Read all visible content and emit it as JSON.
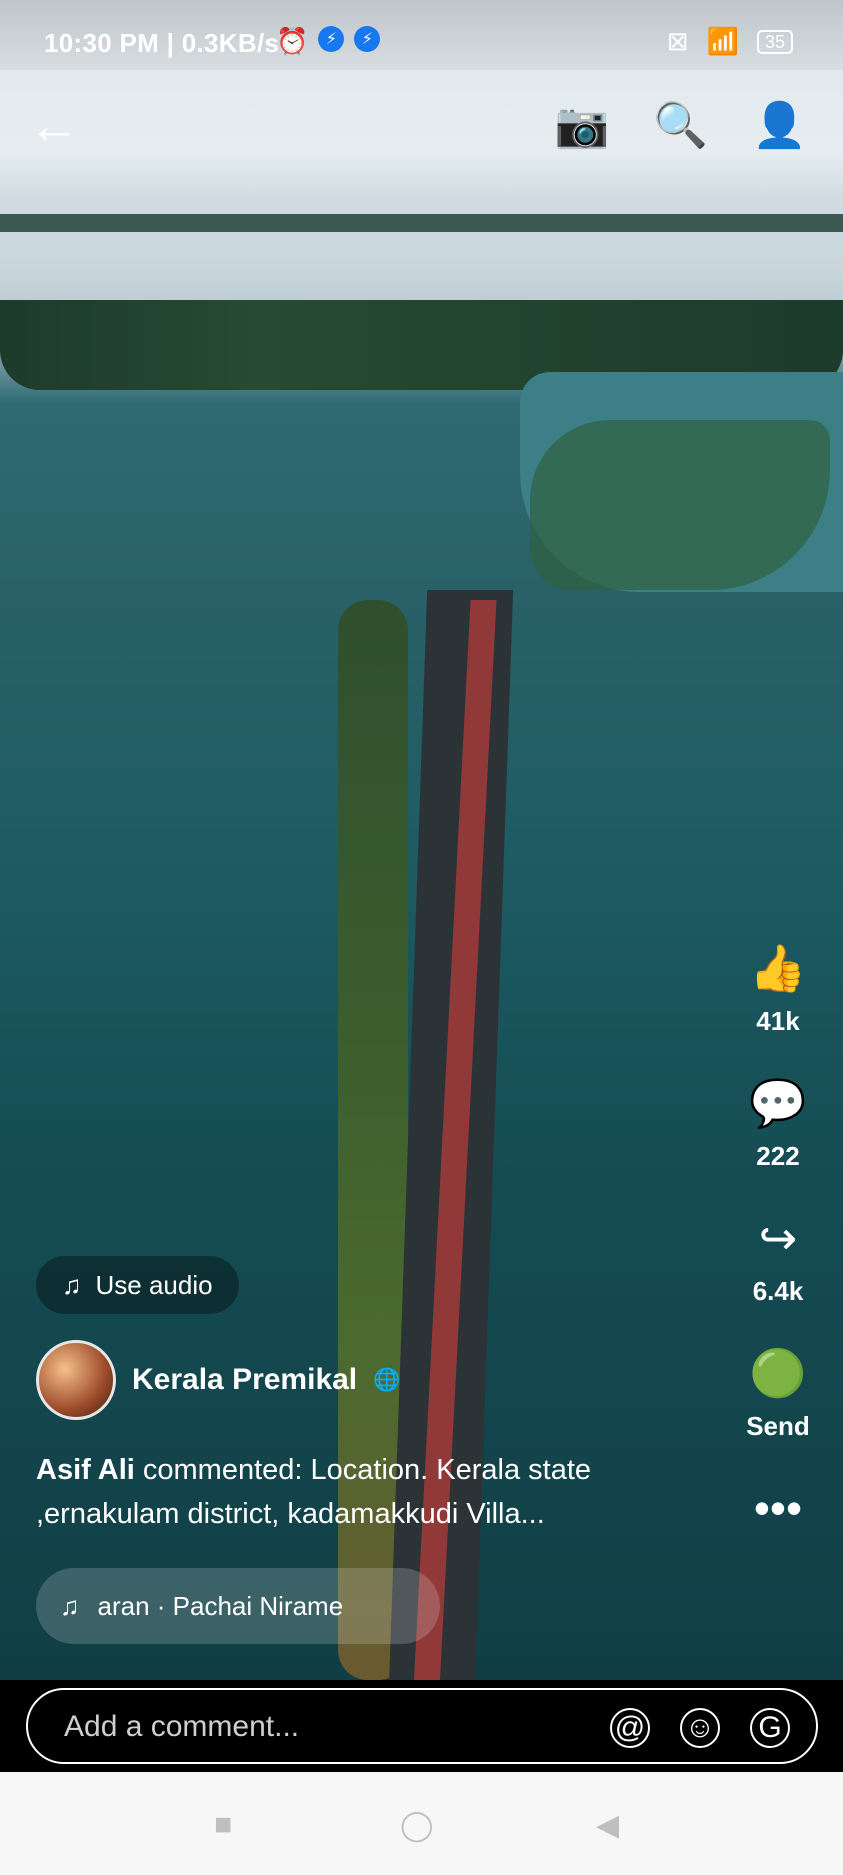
{
  "status": {
    "time": "10:30 PM | 0.3KB/s",
    "battery": "35"
  },
  "topbar": {
    "icons": [
      "back-arrow-icon",
      "camera-icon",
      "search-icon",
      "profile-icon"
    ]
  },
  "actions": {
    "likes": "41k",
    "comments": "222",
    "shares": "6.4k",
    "send_label": "Send"
  },
  "audio": {
    "use_audio": "Use audio",
    "track": "aran · Pachai Nirame"
  },
  "post": {
    "author": "Kerala Premikal",
    "commenter": "Asif Ali",
    "comment_text": " commented: Location.  Kerala state ,ernakulam district, kadamakkudi Villa..."
  },
  "comment_box": {
    "placeholder": "Add a comment..."
  }
}
